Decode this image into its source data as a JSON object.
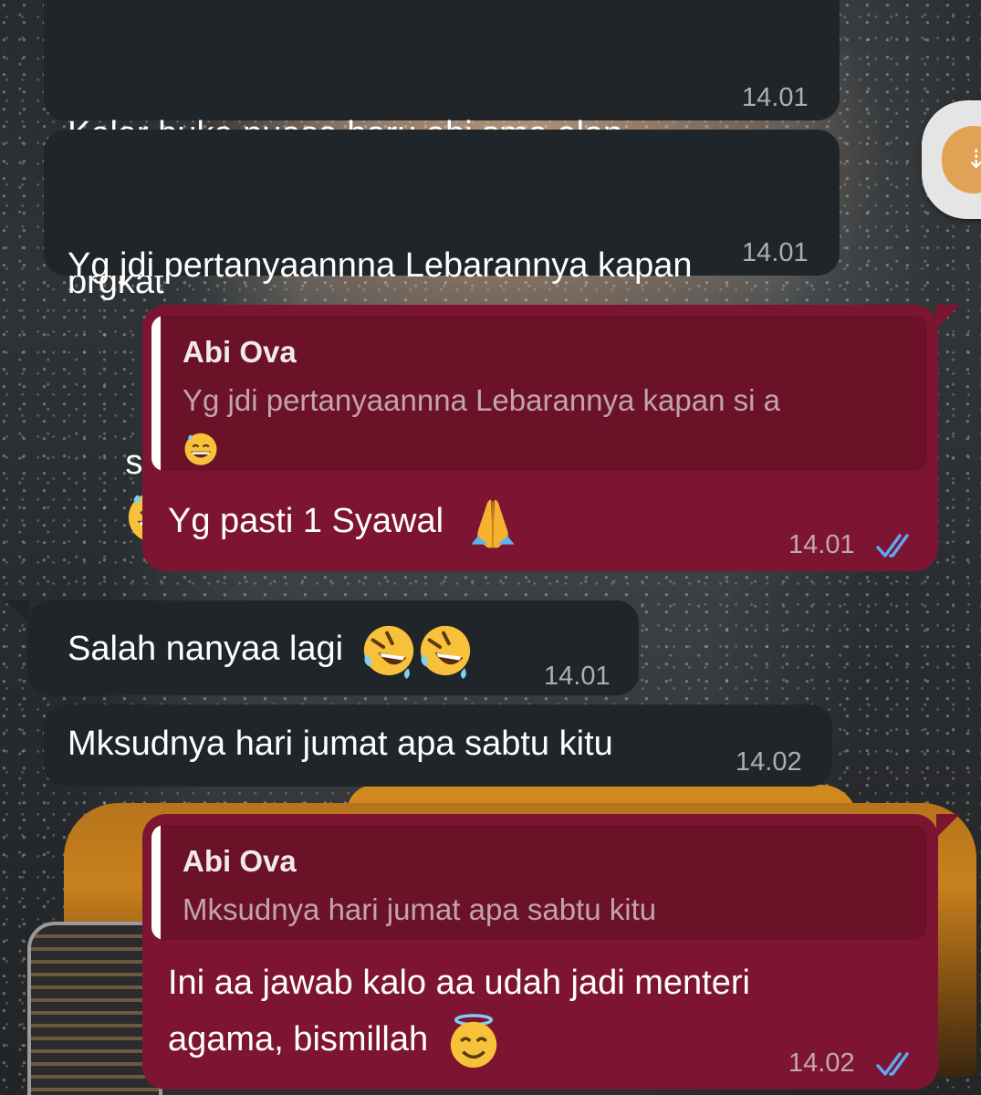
{
  "chat": {
    "messages": [
      {
        "direction": "incoming",
        "text_line1": "Kelar buka puasa baru abi sma alan",
        "text_line2": "brgkat",
        "time": "14.01"
      },
      {
        "direction": "incoming",
        "text_line1": "Yg jdi pertanyaannna Lebarannya kapan",
        "text_line2": "si a",
        "emoji": "grinning-face-with-sweat",
        "time": "14.01"
      },
      {
        "direction": "outgoing",
        "reply_author": "Abi Ova",
        "reply_text": "Yg jdi pertanyaannna Lebarannya kapan si a",
        "reply_emoji": "grinning-face-with-sweat",
        "text": "Yg pasti 1 Syawal",
        "emoji": "folded-hands",
        "time": "14.01",
        "status": "read"
      },
      {
        "direction": "incoming",
        "text": "Salah nanyaa lagi",
        "emoji": "rolling-on-the-floor-laughing",
        "emoji_count": 2,
        "time": "14.01"
      },
      {
        "direction": "incoming",
        "text": "Mksudnya hari jumat apa sabtu kitu",
        "time": "14.02"
      },
      {
        "direction": "outgoing",
        "reply_author": "Abi Ova",
        "reply_text": "Mksudnya hari jumat apa sabtu kitu",
        "text_line1": "Ini aa jawab kalo aa udah jadi menteri",
        "text_line2": "agama, bismillah",
        "emoji": "smiling-face-with-halo",
        "time": "14.02",
        "status": "read"
      }
    ]
  },
  "colors": {
    "incoming_bubble": "#1f2529",
    "outgoing_bubble": "#7d1532",
    "quote_background": "#6b1229",
    "read_ticks": "#5fa8f5"
  }
}
